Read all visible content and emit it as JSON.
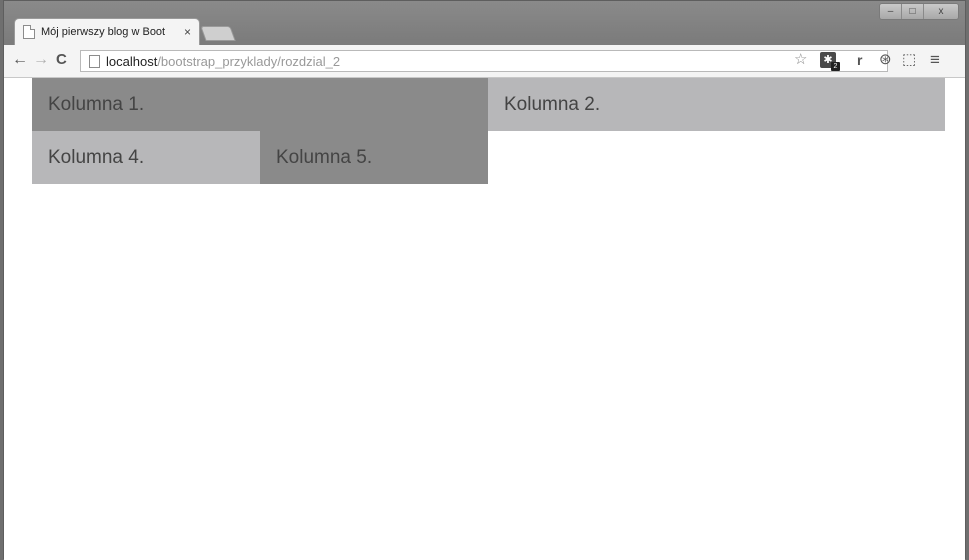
{
  "browser": {
    "tab": {
      "title": "Mój pierwszy blog w Boot",
      "close_glyph": "×"
    },
    "window_controls": {
      "minimize": "–",
      "maximize": "□",
      "close": "x"
    },
    "toolbar": {
      "back_glyph": "←",
      "forward_glyph": "→",
      "reload_glyph": "C",
      "url_host": "localhost",
      "url_path": "/bootstrap_przyklady/rozdzial_2",
      "star_glyph": "☆",
      "extensions": [
        {
          "icon": "puzzle-extension-icon",
          "glyph": "✱",
          "badge": "2"
        },
        {
          "icon": "r-extension-icon",
          "glyph": "r"
        },
        {
          "icon": "globe-extension-icon",
          "glyph": "⊛"
        },
        {
          "icon": "screen-capture-icon",
          "glyph": "⬚"
        }
      ],
      "menu_glyph": "≡"
    }
  },
  "page": {
    "rows": [
      {
        "columns": [
          "Kolumna 1.",
          "Kolumna 2."
        ]
      },
      {
        "columns": [
          "Kolumna 4.",
          "Kolumna 5."
        ]
      }
    ]
  },
  "colors": {
    "dark_cell": "#8a8a8a",
    "light_cell": "#b7b7b9",
    "cell_text": "#444444"
  }
}
